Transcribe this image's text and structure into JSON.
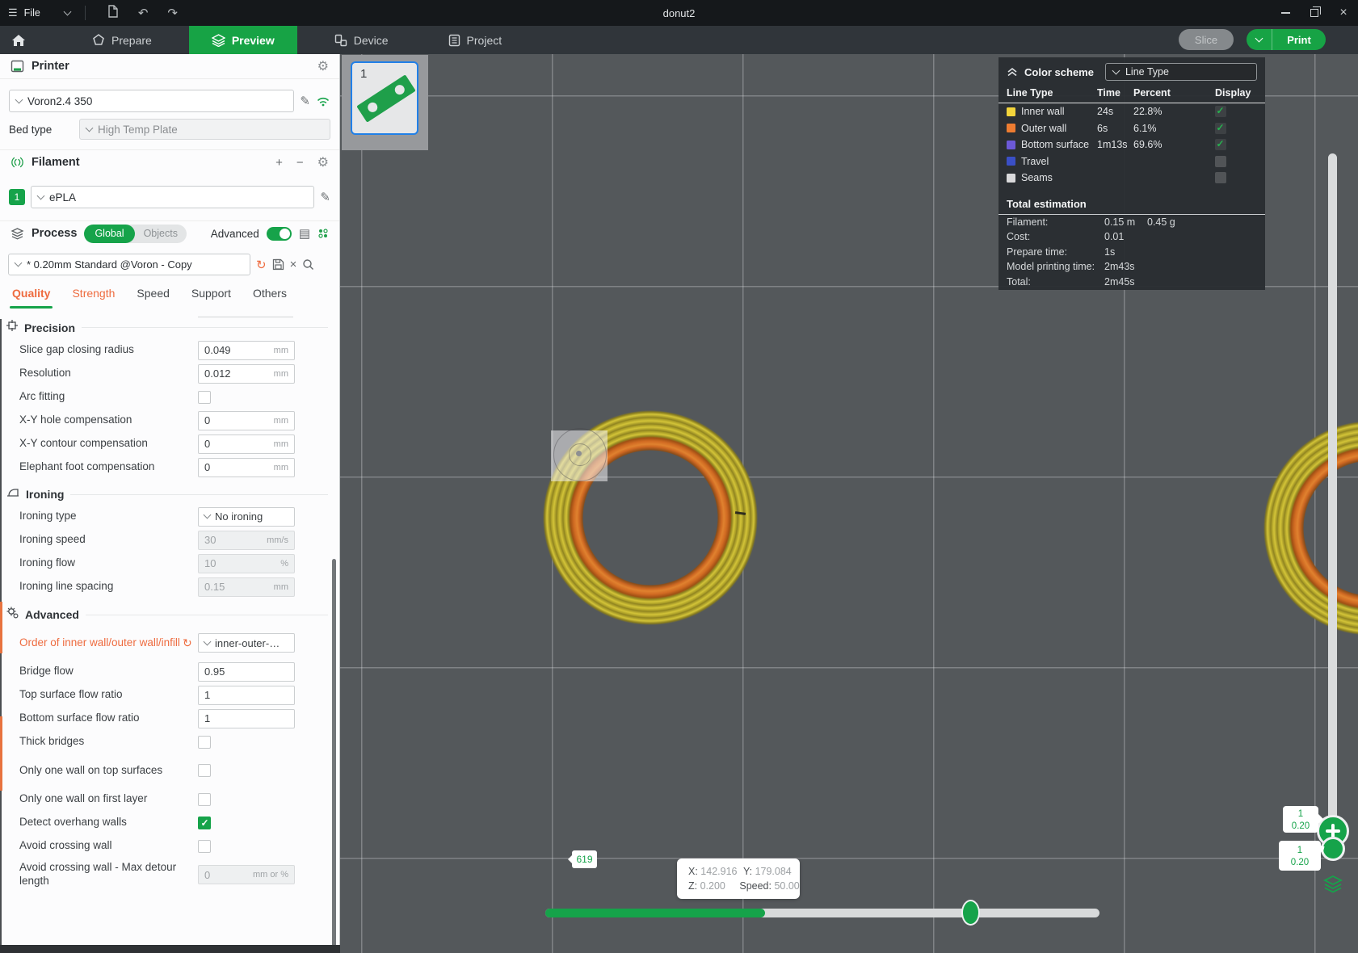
{
  "window": {
    "title": "donut2",
    "file_menu": "File"
  },
  "glyphs": {
    "hamburger": "☰",
    "save_doc": "🗎",
    "undo": "↶",
    "redo": "↷",
    "gear": "⚙",
    "pencil": "✎",
    "plus": "+",
    "minus": "−",
    "list": "▤",
    "reset": "↻",
    "close": "×",
    "search": "⌕"
  },
  "tabs": [
    {
      "label": "Prepare",
      "active": false
    },
    {
      "label": "Preview",
      "active": true
    },
    {
      "label": "Device",
      "active": false
    },
    {
      "label": "Project",
      "active": false
    }
  ],
  "actions": {
    "slice": "Slice",
    "print": "Print"
  },
  "panel": {
    "printer": {
      "section": "Printer",
      "name": "Voron2.4 350",
      "bed_type_label": "Bed type",
      "bed_type": "High Temp Plate"
    },
    "filament": {
      "section": "Filament",
      "index": "1",
      "name": "ePLA"
    },
    "process": {
      "section": "Process",
      "scope_global": "Global",
      "scope_objects": "Objects",
      "advanced_label": "Advanced",
      "preset": "* 0.20mm Standard @Voron - Copy"
    },
    "tabs": [
      {
        "label": "Quality",
        "active": true,
        "modified": true
      },
      {
        "label": "Strength",
        "active": false,
        "modified": true
      },
      {
        "label": "Speed",
        "active": false,
        "modified": false
      },
      {
        "label": "Support",
        "active": false,
        "modified": false
      },
      {
        "label": "Others",
        "active": false,
        "modified": false
      }
    ],
    "sections": [
      {
        "title": "Precision",
        "icon": "precision",
        "rows": [
          {
            "label": "Slice gap closing radius",
            "type": "input",
            "value": "0.049",
            "unit": "mm"
          },
          {
            "label": "Resolution",
            "type": "input",
            "value": "0.012",
            "unit": "mm"
          },
          {
            "label": "Arc fitting",
            "type": "checkbox",
            "checked": false
          },
          {
            "label": "X-Y hole compensation",
            "type": "input",
            "value": "0",
            "unit": "mm"
          },
          {
            "label": "X-Y contour compensation",
            "type": "input",
            "value": "0",
            "unit": "mm"
          },
          {
            "label": "Elephant foot compensation",
            "type": "input",
            "value": "0",
            "unit": "mm"
          }
        ]
      },
      {
        "title": "Ironing",
        "icon": "ironing",
        "rows": [
          {
            "label": "Ironing type",
            "type": "select",
            "value": "No ironing"
          },
          {
            "label": "Ironing speed",
            "type": "input",
            "value": "30",
            "unit": "mm/s",
            "disabled": true
          },
          {
            "label": "Ironing flow",
            "type": "input",
            "value": "10",
            "unit": "%",
            "disabled": true
          },
          {
            "label": "Ironing line spacing",
            "type": "input",
            "value": "0.15",
            "unit": "mm",
            "disabled": true
          }
        ]
      },
      {
        "title": "Advanced",
        "icon": "advanced",
        "rows": [
          {
            "label": "Order of inner wall/outer wall/infill",
            "type": "select",
            "value": "inner-outer-…",
            "modified": true,
            "two_line": true
          },
          {
            "label": "Bridge flow",
            "type": "input",
            "value": "0.95",
            "unit": ""
          },
          {
            "label": "Top surface flow ratio",
            "type": "input",
            "value": "1",
            "unit": ""
          },
          {
            "label": "Bottom surface flow ratio",
            "type": "input",
            "value": "1",
            "unit": ""
          },
          {
            "label": "Thick bridges",
            "type": "checkbox",
            "checked": false
          },
          {
            "label": "Only one wall on top surfaces",
            "type": "checkbox",
            "checked": false,
            "two_line": true
          },
          {
            "label": "Only one wall on first layer",
            "type": "checkbox",
            "checked": false
          },
          {
            "label": "Detect overhang walls",
            "type": "checkbox",
            "checked": true
          },
          {
            "label": "Avoid crossing wall",
            "type": "checkbox",
            "checked": false
          },
          {
            "label": "Avoid crossing wall - Max detour length",
            "type": "input",
            "value": "0",
            "unit": "mm or %",
            "disabled": true,
            "two_line": true
          }
        ]
      }
    ]
  },
  "legend": {
    "title": "Color scheme",
    "view_mode": "Line Type",
    "columns": [
      "Line Type",
      "Time",
      "Percent",
      "Display"
    ],
    "rows": [
      {
        "name": "Inner wall",
        "color": "#F2D43B",
        "time": "24s",
        "percent": "22.8%",
        "display": true
      },
      {
        "name": "Outer wall",
        "color": "#ED7C31",
        "time": "6s",
        "percent": "6.1%",
        "display": true
      },
      {
        "name": "Bottom surface",
        "color": "#6C59D8",
        "time": "1m13s",
        "percent": "69.6%",
        "display": true
      },
      {
        "name": "Travel",
        "color": "#3A4FC6",
        "time": "",
        "percent": "",
        "display": false
      },
      {
        "name": "Seams",
        "color": "#D9D9DB",
        "time": "",
        "percent": "",
        "display": false
      }
    ],
    "totals_title": "Total estimation",
    "totals": [
      {
        "label": "Filament:",
        "value": "0.15 m",
        "value2": "0.45 g"
      },
      {
        "label": "Cost:",
        "value": "0.01",
        "value2": ""
      },
      {
        "label": "Prepare time:",
        "value": "1s",
        "value2": ""
      },
      {
        "label": "Model printing time:",
        "value": "2m43s",
        "value2": ""
      },
      {
        "label": "Total:",
        "value": "2m45s",
        "value2": ""
      }
    ]
  },
  "viewport": {
    "plate_number": "1",
    "tooltip": {
      "x_label": "X:",
      "x": "142.916",
      "y_label": "Y:",
      "y": "179.084",
      "z_label": "Z:",
      "z": "0.200",
      "speed_label": "Speed:",
      "speed": "50.00"
    },
    "hslider": {
      "value": "619"
    },
    "vslider": {
      "top_badge_layer": "1",
      "top_badge_height": "0.20",
      "bottom_badge_layer": "1",
      "bottom_badge_height": "0.20"
    }
  },
  "colors": {
    "accent_green": "#16A34A",
    "modified_orange": "#EE6B3F",
    "viewport_bg": "#54585B"
  }
}
